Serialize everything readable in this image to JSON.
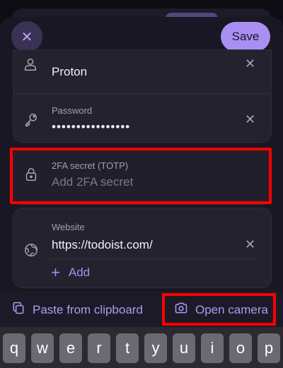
{
  "header": {
    "close_glyph": "✕",
    "save_label": "Save"
  },
  "username": {
    "value": "Proton"
  },
  "password": {
    "label": "Password",
    "value": "••••••••••••••••"
  },
  "totp": {
    "label": "2FA secret (TOTP)",
    "placeholder": "Add 2FA secret"
  },
  "website": {
    "label": "Website",
    "value": "https://todoist.com/",
    "add_label": "Add"
  },
  "toolbar": {
    "paste_label": "Paste from clipboard",
    "camera_label": "Open camera"
  },
  "keyboard": {
    "keys": [
      "q",
      "w",
      "e",
      "r",
      "t",
      "y",
      "u",
      "i",
      "o",
      "p"
    ]
  },
  "colors": {
    "accent": "#a98ff2",
    "highlight": "#ff0000"
  }
}
